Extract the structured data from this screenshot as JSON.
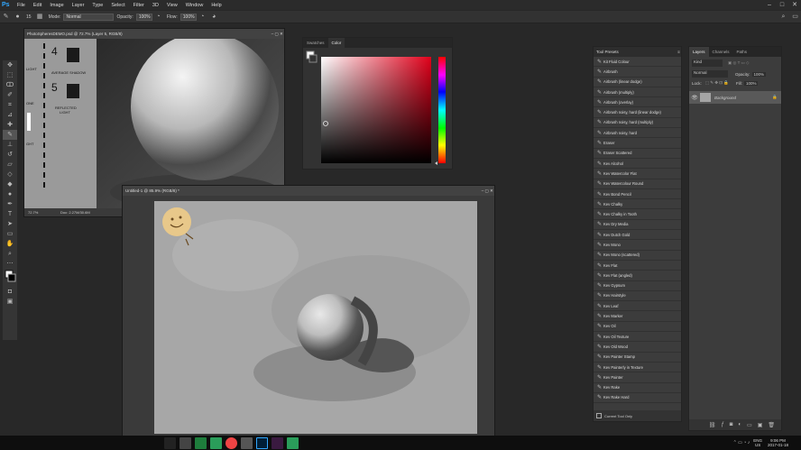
{
  "app": {
    "logo": "Ps"
  },
  "menu": [
    "File",
    "Edit",
    "Image",
    "Layer",
    "Type",
    "Select",
    "Filter",
    "3D",
    "View",
    "Window",
    "Help"
  ],
  "options": {
    "mode_label": "Mode:",
    "mode_value": "Normal",
    "opacity_label": "Opacity:",
    "opacity_value": "100%",
    "flow_label": "Flow:",
    "flow_value": "100%",
    "brush_size": "15"
  },
  "doc1": {
    "title": "PhotoSpheresDEMO.psd @ 72.7% (Layer 5, RGB/8)",
    "zoom": "72.7%",
    "info": "Doc: 2.27M/30.6M",
    "labels": [
      "LIGHT",
      "AVERAGE SHADOW",
      "ONE",
      "REFLECTED LIGHT",
      "GHT"
    ],
    "numbers": [
      "4",
      "5"
    ]
  },
  "doc2": {
    "title": "Untitled-1 @ 85.9% (RGB/8) *"
  },
  "colorpanel": {
    "tabs": [
      "Swatches",
      "Color"
    ]
  },
  "presets": {
    "tab": "Tool Presets",
    "current_only": "Current Tool Only",
    "items": [
      "Kit Fluid Colour",
      "Airbrush",
      "Airbrush (linear dodge)",
      "Airbrush (multiply)",
      "Airbrush (overlay)",
      "Airbrush noisy, hard (linear dodge)",
      "Airbrush noisy, hard (multiply)",
      "Airbrush noisy, hard",
      "Eraser",
      "Eraser Scattered",
      "Kev Alcohol",
      "Kev Watercolor Flat",
      "Kev Watercolour Round",
      "Kev Bond Pencil",
      "Kev Chalky",
      "Kev Chalky in Tooth",
      "Kev Dry Media",
      "Kev Dutch Gold",
      "Kev Mono",
      "Kev Mono (scattered)",
      "Kev Flat",
      "Kev Flat (angled)",
      "Kev Gypsum",
      "Kev Hairstyle",
      "Kev Leaf",
      "Kev Marker",
      "Kev Oil",
      "Kev Oil Texture",
      "Kev Old Wood",
      "Kev Painter Stamp",
      "Kev Painterly in Texture",
      "Kev Painter",
      "Kev Rake",
      "Kev Rake Hard"
    ]
  },
  "layers": {
    "tabs": [
      "Layers",
      "Channels",
      "Paths"
    ],
    "kind": "Kind",
    "blend": "Normal",
    "opacity_label": "Opacity:",
    "opacity": "100%",
    "lock_label": "Lock:",
    "fill_label": "Fill:",
    "fill": "100%",
    "layer_name": "Background"
  },
  "taskbar": {
    "lang": "ENG",
    "region": "US",
    "time": "9:06 PM",
    "date": "2017-01-18"
  },
  "colors": {
    "accent": "#31a8ff"
  }
}
